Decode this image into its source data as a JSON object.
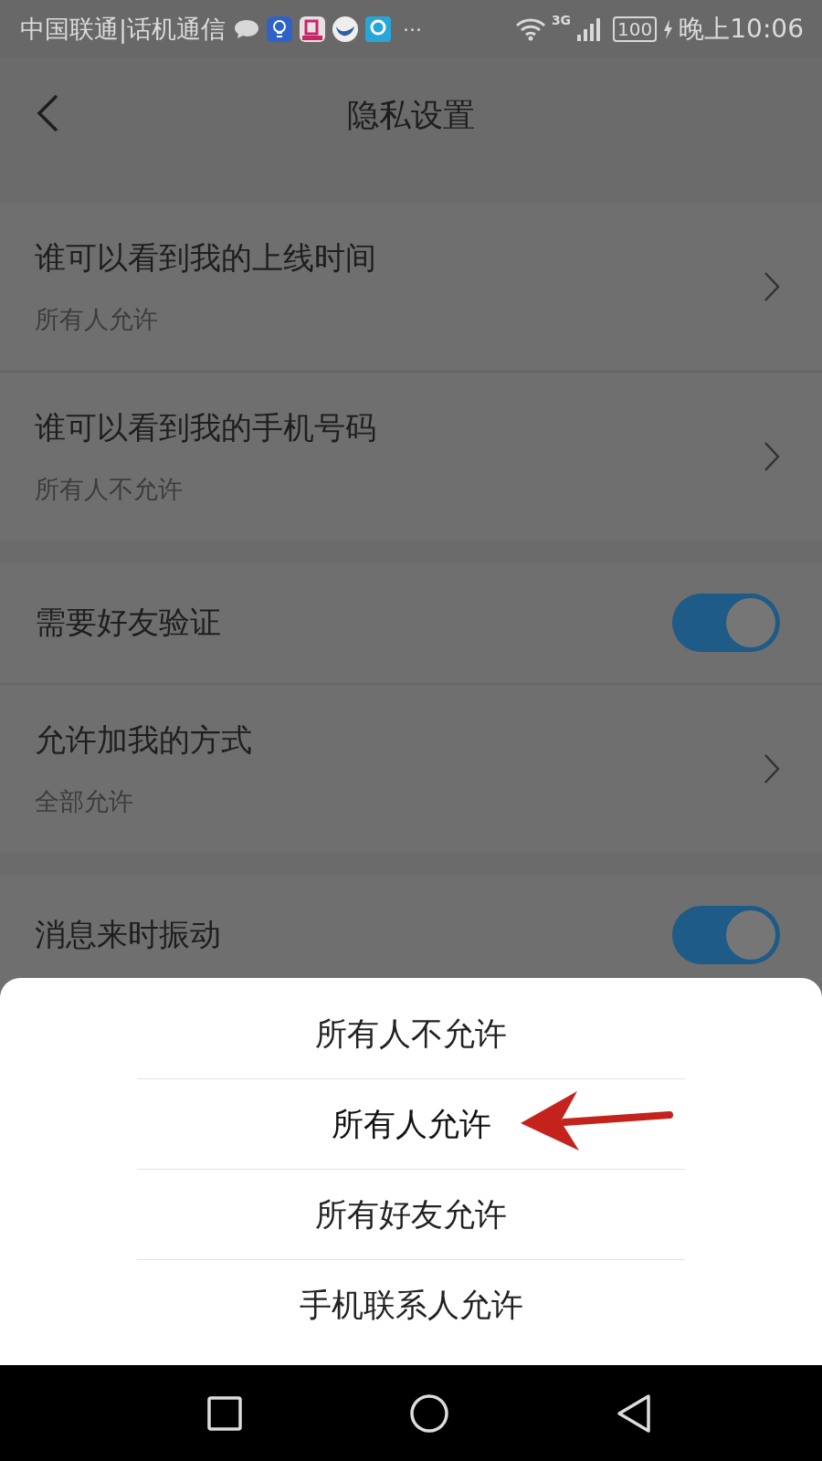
{
  "status_bar": {
    "carrier": "中国联通|话机通信",
    "more": "···",
    "network": "3G",
    "battery": "100",
    "time": "晚上10:06"
  },
  "header": {
    "title": "隐私设置"
  },
  "sections": [
    {
      "items": [
        {
          "kind": "link",
          "title": "谁可以看到我的上线时间",
          "value": "所有人允许"
        },
        {
          "kind": "link",
          "title": "谁可以看到我的手机号码",
          "value": "所有人不允许"
        }
      ]
    },
    {
      "items": [
        {
          "kind": "toggle",
          "title": "需要好友验证",
          "on": true
        },
        {
          "kind": "link",
          "title": "允许加我的方式",
          "value": "全部允许"
        }
      ]
    },
    {
      "items": [
        {
          "kind": "toggle",
          "title": "消息来时振动",
          "on": true
        }
      ]
    }
  ],
  "sheet": {
    "options": [
      {
        "label": "所有人不允许",
        "selected": false
      },
      {
        "label": "所有人允许",
        "selected": true
      },
      {
        "label": "所有好友允许",
        "selected": false
      },
      {
        "label": "手机联系人允许",
        "selected": false
      }
    ]
  }
}
